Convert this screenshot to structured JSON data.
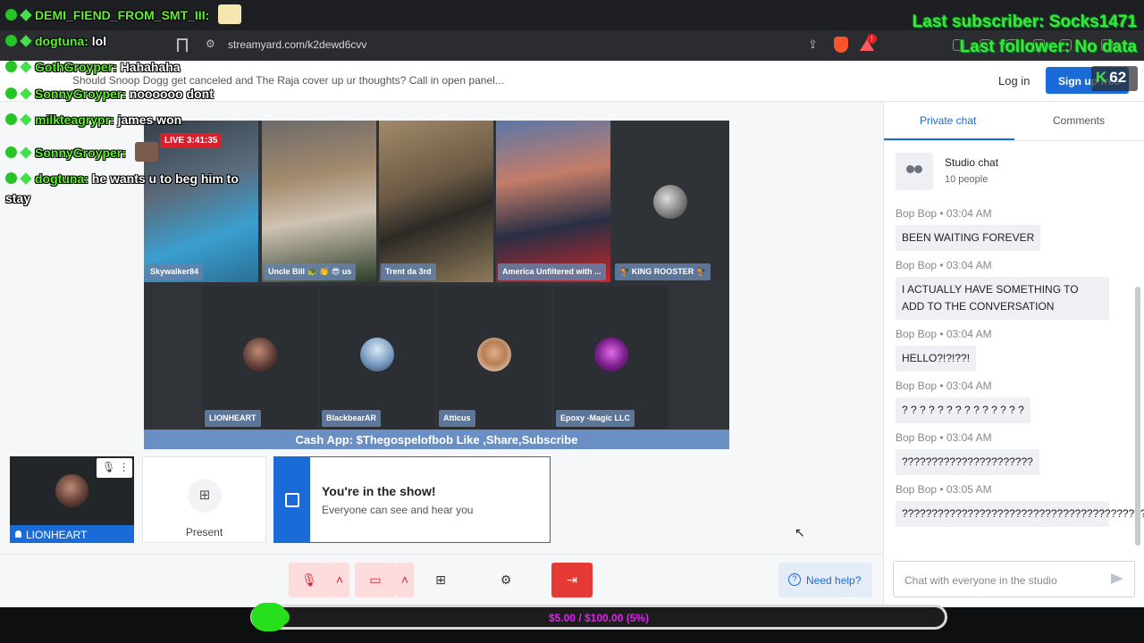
{
  "browser": {
    "url": "streamyard.com/k2dewd6cvv"
  },
  "header": {
    "broadcast_title": "Should Snoop Dogg get canceled and The Raja cover up ur thoughts? Call in open panel...",
    "login_label": "Log in",
    "signup_label": "Sign up free"
  },
  "stage": {
    "live_badge": "LIVE 3:41:35",
    "participants_top": [
      {
        "name": "Skywalker84"
      },
      {
        "name": "Uncle Bill 🐢 👏 😎 us"
      },
      {
        "name": "Trent da 3rd"
      },
      {
        "name": "America Unfiltered with ..."
      },
      {
        "name": "🐓 KING ROOSTER 🐓"
      }
    ],
    "participants_bottom": [
      {
        "name": "LIONHEART"
      },
      {
        "name": "BlackbearAR"
      },
      {
        "name": "Atticus"
      },
      {
        "name": "Epoxy -Magic LLC"
      }
    ],
    "banner": "Cash App: $Thegospelofbob Like ,Share,Subscribe"
  },
  "backstage": {
    "self_name": "LIONHEART",
    "present_label": "Present",
    "show_title": "You're in the show!",
    "show_subtitle": "Everyone can see and hear you"
  },
  "controls": {
    "help_label": "Need help?"
  },
  "chat": {
    "tab_private": "Private chat",
    "tab_comments": "Comments",
    "studio_title": "Studio chat",
    "studio_count": "10 people",
    "messages": [
      {
        "author": "Bop Bop",
        "time": "03:04 AM",
        "text": "BEEN WAITING FOREVER"
      },
      {
        "author": "Bop Bop",
        "time": "03:04 AM",
        "text": "I ACTUALLY HAVE SOMETHING TO ADD TO THE CONVERSATION"
      },
      {
        "author": "Bop Bop",
        "time": "03:04 AM",
        "text": "HELLO?!?!??!"
      },
      {
        "author": "Bop Bop",
        "time": "03:04 AM",
        "text": "? ? ? ? ? ? ? ? ? ? ? ? ? ?"
      },
      {
        "author": "Bop Bop",
        "time": "03:04 AM",
        "text": "??????????????????????"
      },
      {
        "author": "Bop Bop",
        "time": "03:05 AM",
        "text": "?????????????????????????????????????????????"
      }
    ],
    "input_placeholder": "Chat with everyone in the studio"
  },
  "overlay": {
    "chat_lines": [
      {
        "user": "DEMI_FIEND_FROM_SMT_III:",
        "text": ""
      },
      {
        "user": "dogtuna:",
        "text": "lol"
      },
      {
        "user": "GothGroyper:",
        "text": "Hahahaha"
      },
      {
        "user": "SonnyGroyper:",
        "text": "noooooo dont"
      },
      {
        "user": "milkteagrypr:",
        "text": "james won"
      },
      {
        "user": "SonnyGroyper:",
        "text": ""
      },
      {
        "user": "dogtuna:",
        "text": "he wants u to beg him to"
      }
    ],
    "chat_wrap": "stay",
    "last_subscriber": "Last subscriber: Socks1471",
    "last_follower": "Last follower: No data",
    "k_count": "62"
  },
  "donation": {
    "text": "$5.00 / $100.00 (5%)",
    "progress": 0.05
  },
  "colors": {
    "accent": "#1a6bd8",
    "live": "#d6202c",
    "overlay_green": "#3fe23f",
    "donation_text": "#e020ee"
  }
}
